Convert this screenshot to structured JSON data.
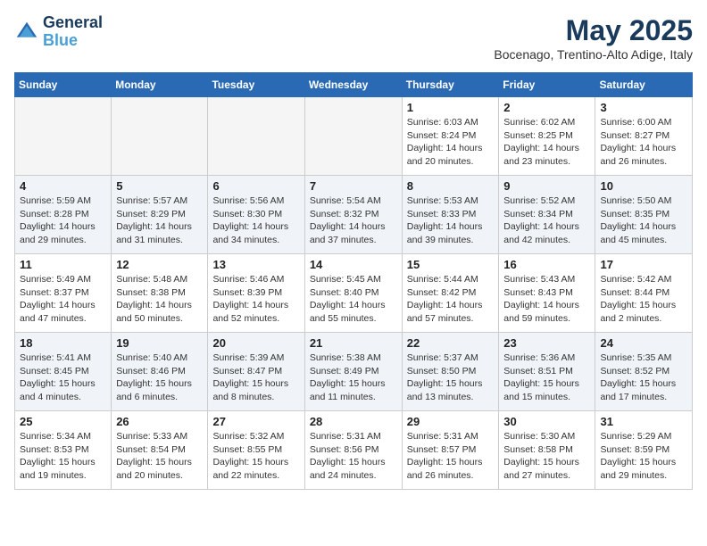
{
  "logo": {
    "line1": "General",
    "line2": "Blue"
  },
  "title": "May 2025",
  "subtitle": "Bocenago, Trentino-Alto Adige, Italy",
  "days_of_week": [
    "Sunday",
    "Monday",
    "Tuesday",
    "Wednesday",
    "Thursday",
    "Friday",
    "Saturday"
  ],
  "weeks": [
    [
      {
        "day": "",
        "info": ""
      },
      {
        "day": "",
        "info": ""
      },
      {
        "day": "",
        "info": ""
      },
      {
        "day": "",
        "info": ""
      },
      {
        "day": "1",
        "info": "Sunrise: 6:03 AM\nSunset: 8:24 PM\nDaylight: 14 hours and 20 minutes."
      },
      {
        "day": "2",
        "info": "Sunrise: 6:02 AM\nSunset: 8:25 PM\nDaylight: 14 hours and 23 minutes."
      },
      {
        "day": "3",
        "info": "Sunrise: 6:00 AM\nSunset: 8:27 PM\nDaylight: 14 hours and 26 minutes."
      }
    ],
    [
      {
        "day": "4",
        "info": "Sunrise: 5:59 AM\nSunset: 8:28 PM\nDaylight: 14 hours and 29 minutes."
      },
      {
        "day": "5",
        "info": "Sunrise: 5:57 AM\nSunset: 8:29 PM\nDaylight: 14 hours and 31 minutes."
      },
      {
        "day": "6",
        "info": "Sunrise: 5:56 AM\nSunset: 8:30 PM\nDaylight: 14 hours and 34 minutes."
      },
      {
        "day": "7",
        "info": "Sunrise: 5:54 AM\nSunset: 8:32 PM\nDaylight: 14 hours and 37 minutes."
      },
      {
        "day": "8",
        "info": "Sunrise: 5:53 AM\nSunset: 8:33 PM\nDaylight: 14 hours and 39 minutes."
      },
      {
        "day": "9",
        "info": "Sunrise: 5:52 AM\nSunset: 8:34 PM\nDaylight: 14 hours and 42 minutes."
      },
      {
        "day": "10",
        "info": "Sunrise: 5:50 AM\nSunset: 8:35 PM\nDaylight: 14 hours and 45 minutes."
      }
    ],
    [
      {
        "day": "11",
        "info": "Sunrise: 5:49 AM\nSunset: 8:37 PM\nDaylight: 14 hours and 47 minutes."
      },
      {
        "day": "12",
        "info": "Sunrise: 5:48 AM\nSunset: 8:38 PM\nDaylight: 14 hours and 50 minutes."
      },
      {
        "day": "13",
        "info": "Sunrise: 5:46 AM\nSunset: 8:39 PM\nDaylight: 14 hours and 52 minutes."
      },
      {
        "day": "14",
        "info": "Sunrise: 5:45 AM\nSunset: 8:40 PM\nDaylight: 14 hours and 55 minutes."
      },
      {
        "day": "15",
        "info": "Sunrise: 5:44 AM\nSunset: 8:42 PM\nDaylight: 14 hours and 57 minutes."
      },
      {
        "day": "16",
        "info": "Sunrise: 5:43 AM\nSunset: 8:43 PM\nDaylight: 14 hours and 59 minutes."
      },
      {
        "day": "17",
        "info": "Sunrise: 5:42 AM\nSunset: 8:44 PM\nDaylight: 15 hours and 2 minutes."
      }
    ],
    [
      {
        "day": "18",
        "info": "Sunrise: 5:41 AM\nSunset: 8:45 PM\nDaylight: 15 hours and 4 minutes."
      },
      {
        "day": "19",
        "info": "Sunrise: 5:40 AM\nSunset: 8:46 PM\nDaylight: 15 hours and 6 minutes."
      },
      {
        "day": "20",
        "info": "Sunrise: 5:39 AM\nSunset: 8:47 PM\nDaylight: 15 hours and 8 minutes."
      },
      {
        "day": "21",
        "info": "Sunrise: 5:38 AM\nSunset: 8:49 PM\nDaylight: 15 hours and 11 minutes."
      },
      {
        "day": "22",
        "info": "Sunrise: 5:37 AM\nSunset: 8:50 PM\nDaylight: 15 hours and 13 minutes."
      },
      {
        "day": "23",
        "info": "Sunrise: 5:36 AM\nSunset: 8:51 PM\nDaylight: 15 hours and 15 minutes."
      },
      {
        "day": "24",
        "info": "Sunrise: 5:35 AM\nSunset: 8:52 PM\nDaylight: 15 hours and 17 minutes."
      }
    ],
    [
      {
        "day": "25",
        "info": "Sunrise: 5:34 AM\nSunset: 8:53 PM\nDaylight: 15 hours and 19 minutes."
      },
      {
        "day": "26",
        "info": "Sunrise: 5:33 AM\nSunset: 8:54 PM\nDaylight: 15 hours and 20 minutes."
      },
      {
        "day": "27",
        "info": "Sunrise: 5:32 AM\nSunset: 8:55 PM\nDaylight: 15 hours and 22 minutes."
      },
      {
        "day": "28",
        "info": "Sunrise: 5:31 AM\nSunset: 8:56 PM\nDaylight: 15 hours and 24 minutes."
      },
      {
        "day": "29",
        "info": "Sunrise: 5:31 AM\nSunset: 8:57 PM\nDaylight: 15 hours and 26 minutes."
      },
      {
        "day": "30",
        "info": "Sunrise: 5:30 AM\nSunset: 8:58 PM\nDaylight: 15 hours and 27 minutes."
      },
      {
        "day": "31",
        "info": "Sunrise: 5:29 AM\nSunset: 8:59 PM\nDaylight: 15 hours and 29 minutes."
      }
    ]
  ]
}
